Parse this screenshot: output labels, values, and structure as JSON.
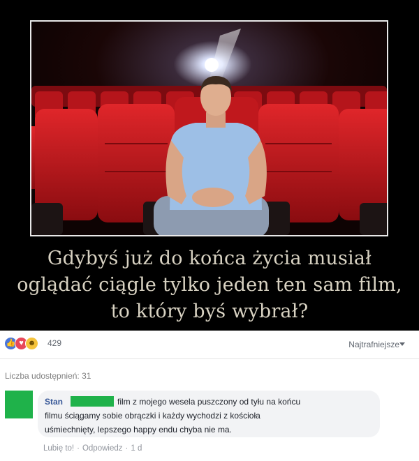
{
  "meme": {
    "caption_lines": [
      "Gdybyś już do końca życia musiał",
      "oglądać ciągle tylko jeden ten sam film,",
      "to który byś wybrał?"
    ]
  },
  "reactions": {
    "icons": [
      "like-icon",
      "love-icon",
      "haha-icon"
    ],
    "count": "429",
    "sort_label": "Najtrafniejsze"
  },
  "shares_text": "Liczba udostępnień: 31",
  "comment": {
    "author": "Stan",
    "lines": [
      "film z mojego wesela puszczony od tyłu  na końcu",
      "filmu ściągamy sobie obrączki i każdy wychodzi z kościoła",
      "uśmiechnięty, lepszego happy endu chyba nie ma."
    ],
    "like_label": "Lubię to!",
    "reply_label": "Odpowiedz",
    "time": "1 d",
    "separator": "·"
  },
  "colors": {
    "seat_red": "#c8141c",
    "censor_green": "#1fb24a",
    "link_blue": "#385898"
  }
}
